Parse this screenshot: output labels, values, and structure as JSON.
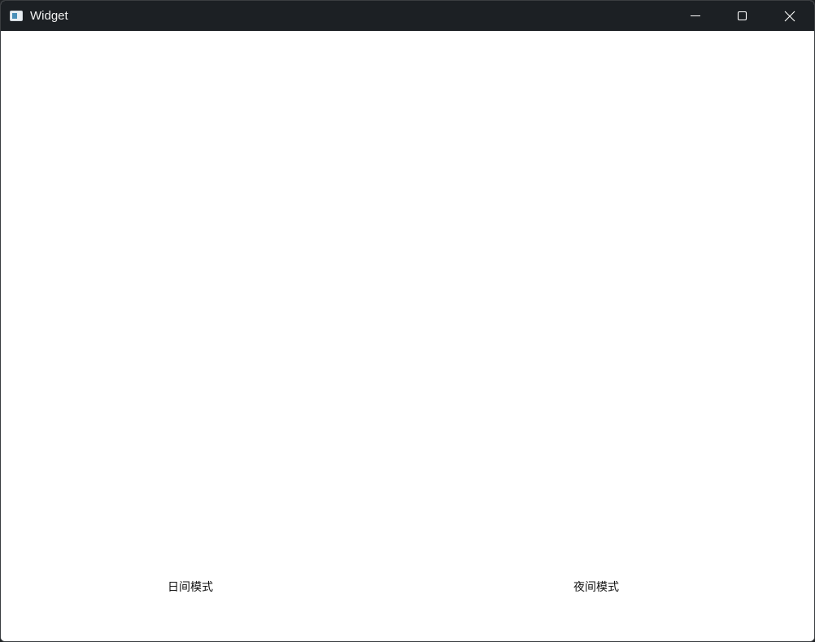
{
  "window": {
    "title": "Widget"
  },
  "titlebar": {
    "icon": "app-window-icon",
    "controls": [
      "minimize-icon",
      "maximize-icon",
      "close-icon"
    ]
  },
  "colors": {
    "titlebar_bg": "#1c2024",
    "content_bg": "#ffffff",
    "text": "#111111"
  },
  "buttons": {
    "day_mode": "日间模式",
    "night_mode": "夜间模式"
  }
}
